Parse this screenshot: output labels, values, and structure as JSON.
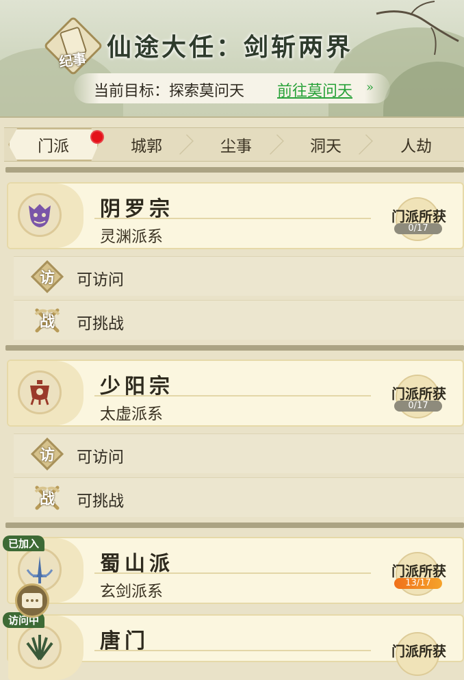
{
  "header": {
    "badge_label": "纪事",
    "title": "仙途大任：剑斩两界",
    "goal_label": "当前目标：探索莫问天",
    "goal_link": "前往莫问天",
    "goal_arrow": "»"
  },
  "tabs": [
    {
      "label": "门派",
      "active": true,
      "has_notice": true
    },
    {
      "label": "城郭",
      "active": false
    },
    {
      "label": "尘事",
      "active": false
    },
    {
      "label": "洞天",
      "active": false
    },
    {
      "label": "人劫",
      "active": false
    }
  ],
  "sects": [
    {
      "name": "阴罗宗",
      "lineage": "灵渊派系",
      "reward_label": "门派所获",
      "reward_count": "0/17",
      "reward_progress": 0,
      "emblem": "demon-mask-icon",
      "emblem_color": "#7a55a8",
      "actions": [
        {
          "icon_char": "访",
          "label": "可访问"
        },
        {
          "icon_char": "战",
          "label": "可挑战"
        }
      ]
    },
    {
      "name": "少阳宗",
      "lineage": "太虚派系",
      "reward_label": "门派所获",
      "reward_count": "0/17",
      "reward_progress": 0,
      "emblem": "cauldron-icon",
      "emblem_color": "#9a3a2a",
      "actions": [
        {
          "icon_char": "访",
          "label": "可访问"
        },
        {
          "icon_char": "战",
          "label": "可挑战"
        }
      ]
    },
    {
      "name": "蜀山派",
      "lineage": "玄剑派系",
      "reward_label": "门派所获",
      "reward_count": "13/17",
      "reward_progress": 0.76,
      "status_tag": "已加入",
      "emblem": "sword-icon",
      "emblem_color": "#4a6fa8"
    },
    {
      "name": "唐门",
      "reward_label": "门派所获",
      "status_tag": "访问中",
      "emblem": "fan-icon",
      "emblem_color": "#3a5a3a"
    }
  ]
}
